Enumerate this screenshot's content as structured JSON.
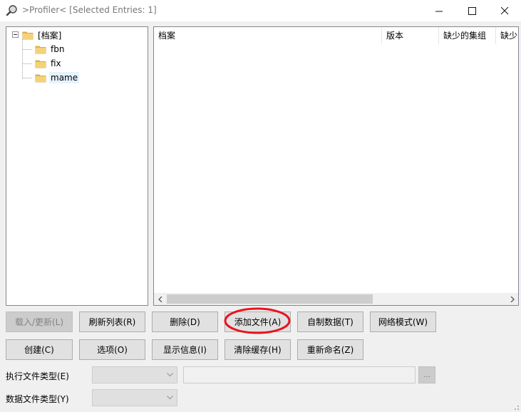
{
  "window": {
    "title": ">Profiler<  [Selected Entries: 1]",
    "app_icon": "magnifier-icon",
    "controls": [
      "minimize-icon",
      "maximize-icon",
      "close-icon"
    ]
  },
  "tree": {
    "root": "[档案]",
    "children": [
      "fbn",
      "fix",
      "mame"
    ],
    "selected": "mame"
  },
  "list": {
    "columns": [
      "档案",
      "版本",
      "缺少的集组",
      "缺少"
    ]
  },
  "buttons": {
    "row1": [
      "载入/更新(L)",
      "刷新列表(R)",
      "删除(D)",
      "添加文件(A)",
      "自制数据(T)",
      "网络模式(W)"
    ],
    "row2": [
      "创建(C)",
      "选项(O)",
      "显示信息(I)",
      "清除缓存(H)",
      "重新命名(Z)"
    ],
    "disabled": [
      "载入/更新(L)"
    ],
    "highlighted": "添加文件(A)"
  },
  "fields": {
    "exec_type_label": "执行文件类型(E)",
    "data_type_label": "数据文件类型(Y)",
    "browse_label": "..."
  },
  "colors": {
    "highlight_circle": "#e8141e",
    "selection": "#e5f3ff"
  }
}
